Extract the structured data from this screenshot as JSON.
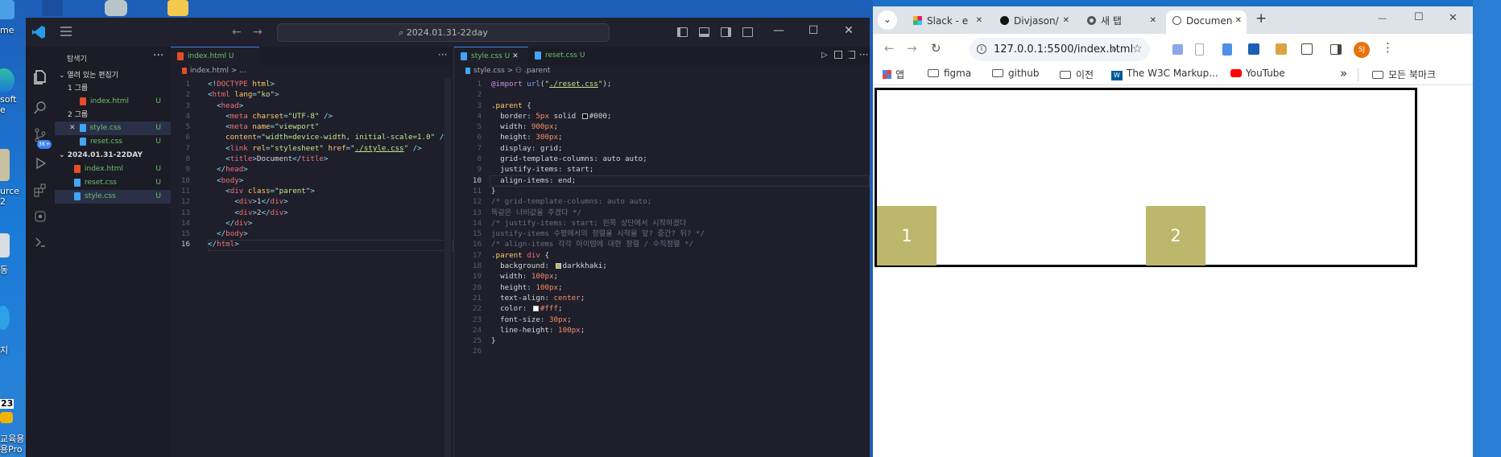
{
  "desktop": {
    "labels": [
      "me",
      "soft",
      "e",
      "urce",
      "2",
      "동",
      "지",
      "23",
      "교육용",
      "용Pro"
    ]
  },
  "vscode": {
    "title": {
      "search": "2024.01.31-22day",
      "back": "←",
      "fwd": "→",
      "minimize": "—",
      "maximize": "☐",
      "close": "✕"
    },
    "sidebar": {
      "header": "탐색기",
      "more": "···",
      "sections": [
        {
          "label": "열려 있는 편집기"
        },
        {
          "label": "1 그룹"
        },
        {
          "label": "index.html",
          "badge": "U"
        },
        {
          "label": "2 그룹"
        },
        {
          "label": "style.css",
          "badge": "U",
          "close": "✕"
        },
        {
          "label": "reset.css",
          "badge": "U"
        },
        {
          "label": "2024.01.31-22DAY"
        },
        {
          "label": "index.html",
          "badge": "U"
        },
        {
          "label": "reset.css",
          "badge": "U"
        },
        {
          "label": "style.css",
          "badge": "U"
        }
      ]
    },
    "left_editor": {
      "tab": "index.html",
      "tab_badge": "U",
      "crumb": "index.html > ...",
      "more": "···",
      "line_numbers": [
        "1",
        "2",
        "3",
        "4",
        "5",
        "",
        "6",
        "7",
        "8",
        "9",
        "10",
        "11",
        "12",
        "13",
        "14",
        "15",
        "16"
      ]
    },
    "right_editor": {
      "tabs": [
        {
          "label": "style.css",
          "badge": "U",
          "close": "✕"
        },
        {
          "label": "reset.css",
          "badge": "U"
        }
      ],
      "crumb": "style.css > ⚇ .parent",
      "more": "···",
      "line_numbers": [
        "1",
        "2",
        "3",
        "4",
        "5",
        "6",
        "7",
        "8",
        "9",
        "10",
        "11",
        "12",
        "13",
        "14",
        "15",
        "16",
        "17",
        "18",
        "19",
        "20",
        "21",
        "22",
        "23",
        "24",
        "25",
        "26"
      ]
    }
  },
  "chrome": {
    "tabs": [
      {
        "label": "Slack - e"
      },
      {
        "label": "Divjason/"
      },
      {
        "label": "새 탭"
      },
      {
        "label": "Documen"
      }
    ],
    "new_tab": "+",
    "minimize": "—",
    "maximize": "☐",
    "close": "✕",
    "url": "127.0.0.1:5500/index.html",
    "profile": "SJ",
    "bookmarks": [
      {
        "label": "앱"
      },
      {
        "label": "figma"
      },
      {
        "label": "github"
      },
      {
        "label": "이전"
      },
      {
        "label": "The W3C Markup..."
      },
      {
        "label": "YouTube"
      }
    ],
    "bookmarks_more": "»",
    "all_bookmarks": "모든 북마크",
    "page": {
      "boxes": [
        "1",
        "2"
      ]
    }
  },
  "colors": {
    "darkkhaki": "#bdb76b",
    "vscode_bg": "#1e1f2a",
    "desktop": "#1c6fc9"
  }
}
